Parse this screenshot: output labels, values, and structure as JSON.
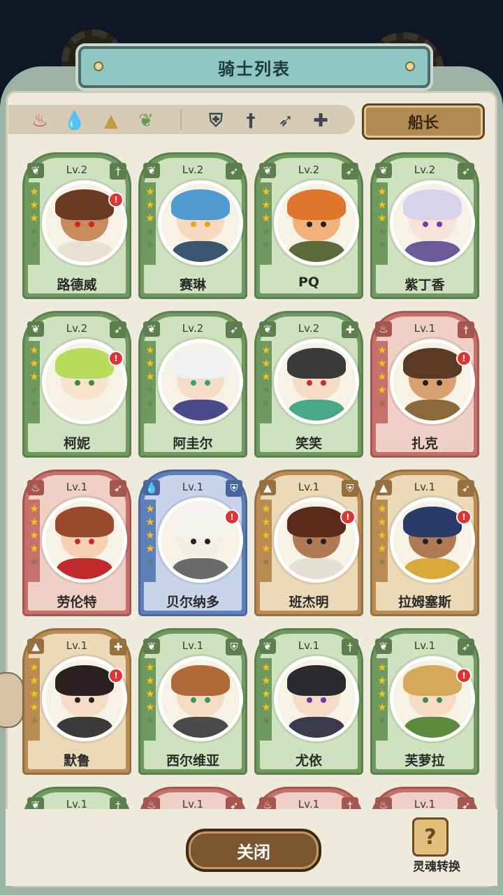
{
  "header": {
    "title": "骑士列表"
  },
  "filters": {
    "elements": [
      {
        "icon": "fire-icon",
        "glyph": "♨",
        "color": "#c84a3c"
      },
      {
        "icon": "water-drop-icon",
        "glyph": "💧",
        "color": "#4a7fc4"
      },
      {
        "icon": "earth-icon",
        "glyph": "▲",
        "color": "#c69a3e"
      },
      {
        "icon": "leaf-icon",
        "glyph": "❦",
        "color": "#6b9a4c"
      }
    ],
    "classes": [
      {
        "icon": "shield-icon",
        "glyph": "⛨",
        "color": "#3e4654"
      },
      {
        "icon": "sword-icon",
        "glyph": "†",
        "color": "#3e4654"
      },
      {
        "icon": "bow-icon",
        "glyph": "➶",
        "color": "#3e4654"
      },
      {
        "icon": "cross-icon",
        "glyph": "✚",
        "color": "#3e4654"
      }
    ],
    "captain_label": "船长"
  },
  "knights": [
    {
      "name": "路德威",
      "level": "Lv.2",
      "theme": "green",
      "stars": 3,
      "new": true,
      "class": "sword",
      "hair": "#6a3a22",
      "skin": "#c98a5c",
      "outfit": "#e9e2d3",
      "eye": "#c22"
    },
    {
      "name": "赛琳",
      "level": "Lv.2",
      "theme": "green",
      "stars": 3,
      "new": false,
      "class": "bow",
      "hair": "#4f9ad0",
      "skin": "#f6d9bf",
      "outfit": "#3a5570",
      "eye": "#e8a21c"
    },
    {
      "name": "PQ",
      "level": "Lv.2",
      "theme": "green",
      "stars": 3,
      "new": false,
      "class": "bow",
      "hair": "#e0752c",
      "skin": "#f2b07a",
      "outfit": "#5c6a3a",
      "eye": "#222"
    },
    {
      "name": "紫丁香",
      "level": "Lv.2",
      "theme": "green",
      "stars": 3,
      "new": false,
      "class": "bow",
      "hair": "#d8d2ea",
      "skin": "#f8e2da",
      "outfit": "#6a5a9a",
      "eye": "#7a3ab0"
    },
    {
      "name": "柯妮",
      "level": "Lv.2",
      "theme": "green",
      "stars": 3,
      "new": true,
      "class": "bow",
      "hair": "#b8dc5a",
      "skin": "#f8e2cc",
      "outfit": "#f4f0e4",
      "eye": "#3a8a3a"
    },
    {
      "name": "阿圭尔",
      "level": "Lv.2",
      "theme": "green",
      "stars": 3,
      "new": false,
      "class": "bow",
      "hair": "#eef0f2",
      "skin": "#f6dcc4",
      "outfit": "#4a4a8a",
      "eye": "#3aa070"
    },
    {
      "name": "笑笑",
      "level": "Lv.2",
      "theme": "green",
      "stars": 3,
      "new": false,
      "class": "cross",
      "hair": "#3a3a3a",
      "skin": "#f6dcc4",
      "outfit": "#4aa88a",
      "eye": "#c03030"
    },
    {
      "name": "扎克",
      "level": "Lv.1",
      "theme": "red",
      "stars": 4,
      "new": true,
      "class": "sword",
      "hair": "#5a3a22",
      "skin": "#d8a070",
      "outfit": "#8a6a3a",
      "eye": "#222"
    },
    {
      "name": "劳伦特",
      "level": "Lv.1",
      "theme": "red",
      "stars": 4,
      "new": false,
      "class": "bow",
      "hair": "#9a4a2a",
      "skin": "#f6d0b4",
      "outfit": "#c02a2a",
      "eye": "#c02a2a"
    },
    {
      "name": "贝尔纳多",
      "level": "Lv.1",
      "theme": "blue",
      "stars": 4,
      "new": true,
      "class": "shield",
      "hair": "#f4f2ee",
      "skin": "#f2efe8",
      "outfit": "#6a6a6a",
      "eye": "#222"
    },
    {
      "name": "班杰明",
      "level": "Lv.1",
      "theme": "gold",
      "stars": 4,
      "new": true,
      "class": "shield",
      "hair": "#5a2a1a",
      "skin": "#b07a54",
      "outfit": "#e4e0d4",
      "eye": "#222"
    },
    {
      "name": "拉姆塞斯",
      "level": "Lv.1",
      "theme": "gold",
      "stars": 4,
      "new": true,
      "class": "bow",
      "hair": "#2a3a6a",
      "skin": "#b07a54",
      "outfit": "#d8a83a",
      "eye": "#222"
    },
    {
      "name": "默鲁",
      "level": "Lv.1",
      "theme": "gold",
      "stars": 4,
      "new": true,
      "class": "cross",
      "hair": "#2a2222",
      "skin": "#f6dcc4",
      "outfit": "#3a3a3a",
      "eye": "#222"
    },
    {
      "name": "西尔维亚",
      "level": "Lv.1",
      "theme": "green",
      "stars": 4,
      "new": false,
      "class": "shield",
      "hair": "#b06a3a",
      "skin": "#f6dcc4",
      "outfit": "#4a4a4a",
      "eye": "#3a9a5a"
    },
    {
      "name": "尤依",
      "level": "Lv.1",
      "theme": "green",
      "stars": 4,
      "new": false,
      "class": "sword",
      "hair": "#2a2a30",
      "skin": "#f6dcc4",
      "outfit": "#3a3a4a",
      "eye": "#6a3aa0"
    },
    {
      "name": "芙萝拉",
      "level": "Lv.1",
      "theme": "green",
      "stars": 4,
      "new": true,
      "class": "bow",
      "hair": "#d8a85a",
      "skin": "#f6dcc4",
      "outfit": "#5a8a3a",
      "eye": "#3a8a5a"
    },
    {
      "name": "",
      "level": "Lv.1",
      "theme": "green",
      "stars": 4,
      "new": false,
      "class": "sword",
      "hair": "#888",
      "skin": "#eee",
      "outfit": "#777",
      "eye": "#222"
    },
    {
      "name": "",
      "level": "Lv.1",
      "theme": "red",
      "stars": 4,
      "new": false,
      "class": "bow",
      "hair": "#888",
      "skin": "#eee",
      "outfit": "#777",
      "eye": "#222"
    },
    {
      "name": "",
      "level": "Lv.1",
      "theme": "red",
      "stars": 4,
      "new": false,
      "class": "sword",
      "hair": "#888",
      "skin": "#eee",
      "outfit": "#777",
      "eye": "#222"
    },
    {
      "name": "",
      "level": "Lv.1",
      "theme": "red",
      "stars": 4,
      "new": false,
      "class": "bow",
      "hair": "#888",
      "skin": "#eee",
      "outfit": "#777",
      "eye": "#222"
    }
  ],
  "footer": {
    "close_label": "关闭",
    "soul_label": "灵魂转换",
    "soul_glyph": "?"
  }
}
